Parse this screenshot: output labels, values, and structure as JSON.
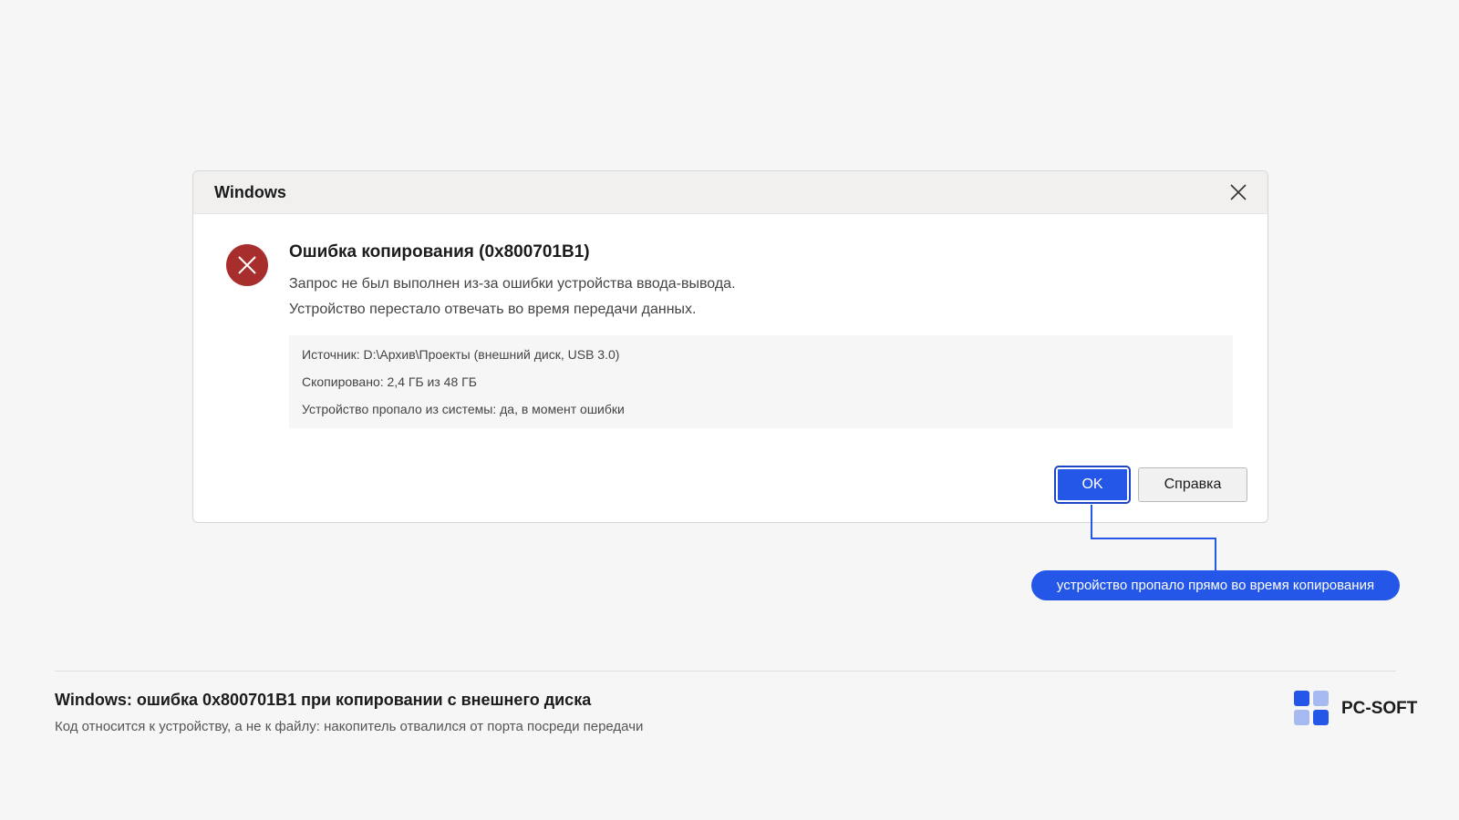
{
  "dialog": {
    "title": "Windows",
    "heading": "Ошибка копирования  (0x800701B1)",
    "message_line1": "Запрос не был выполнен из-за ошибки устройства ввода-вывода.",
    "message_line2": "Устройство перестало отвечать во время передачи данных.",
    "details": [
      "Источник:  D:\\Архив\\Проекты  (внешний диск, USB 3.0)",
      "Скопировано:  2,4 ГБ из 48 ГБ",
      "Устройство пропало из системы:  да, в момент ошибки"
    ],
    "ok_label": "OK",
    "help_label": "Справка"
  },
  "callout": {
    "text": "устройство пропало прямо во время копирования"
  },
  "footer": {
    "title": "Windows: ошибка 0x800701B1 при копировании с внешнего диска",
    "subtitle": "Код относится к устройству, а не к файлу: накопитель отвалился от порта посреди передачи",
    "brand": "PC-SOFT"
  },
  "colors": {
    "accent": "#2457e8",
    "error": "#a82e2e",
    "background": "#f6f6f6"
  },
  "icons": {
    "close": "close-icon",
    "error": "error-icon"
  }
}
